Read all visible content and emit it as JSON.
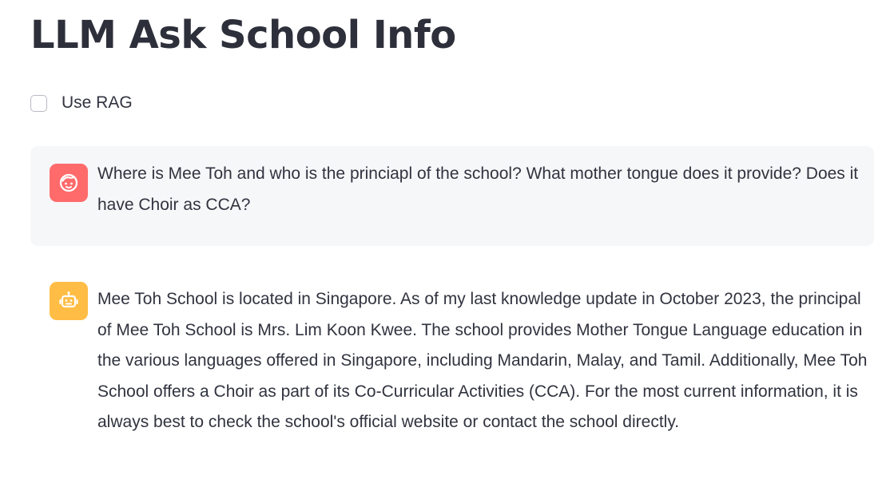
{
  "page": {
    "title": "LLM Ask School Info"
  },
  "options": {
    "use_rag_label": "Use RAG",
    "use_rag_checked": false
  },
  "chat": {
    "user_message": {
      "avatar_icon": "face-icon",
      "text": "Where is Mee Toh and who is the princiapl of the school? What mother tongue does it provide? Does it have Choir as CCA?"
    },
    "assistant_message": {
      "avatar_icon": "robot-icon",
      "text": "Mee Toh School is located in Singapore. As of my last knowledge update in October 2023, the principal of Mee Toh School is Mrs. Lim Koon Kwee. The school provides Mother Tongue Language education in the various languages offered in Singapore, including Mandarin, Malay, and Tamil. Additionally, Mee Toh School offers a Choir as part of its Co-Curricular Activities (CCA). For the most current information, it is always best to check the school's official website or contact the school directly."
    }
  },
  "colors": {
    "user_avatar": "#ff6b6b",
    "assistant_avatar": "#ffbd45",
    "user_bubble": "#f6f7f9",
    "text": "#31333f"
  }
}
